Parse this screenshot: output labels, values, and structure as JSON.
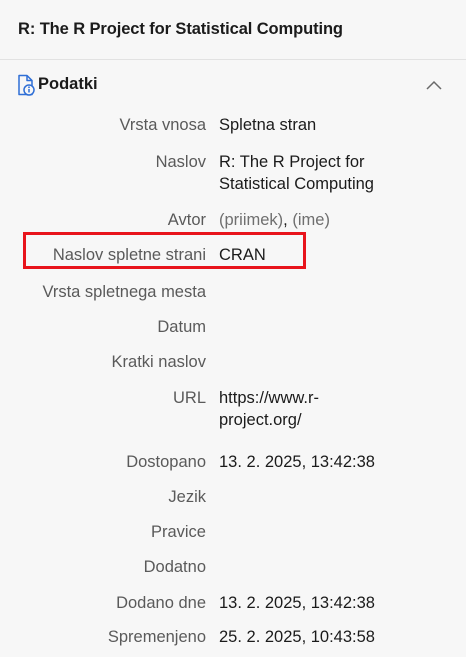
{
  "header": {
    "title": "R: The R Project for Statistical Computing"
  },
  "section": {
    "title": "Podatki",
    "icon": "document-info-icon",
    "collapse_icon": "chevron-up-icon"
  },
  "fields": {
    "item_type": {
      "label": "Vrsta vnosa",
      "value": "Spletna stran"
    },
    "title": {
      "label": "Naslov",
      "value_line1": "R: The R Project for",
      "value_line2": "Statistical Computing"
    },
    "author": {
      "label": "Avtor",
      "last": "(priimek)",
      "sep": ",",
      "first": "(ime)"
    },
    "website_title": {
      "label": "Naslov spletne strani",
      "value": "CRAN"
    },
    "website_type": {
      "label": "Vrsta spletnega mesta",
      "value": ""
    },
    "date": {
      "label": "Datum",
      "value": ""
    },
    "short_title": {
      "label": "Kratki naslov",
      "value": ""
    },
    "url": {
      "label": "URL",
      "value_line1": "https://www.r-",
      "value_line2": "project.org/"
    },
    "accessed": {
      "label": "Dostopano",
      "value": "13. 2. 2025, 13:42:38"
    },
    "language": {
      "label": "Jezik",
      "value": ""
    },
    "rights": {
      "label": "Pravice",
      "value": ""
    },
    "extra": {
      "label": "Dodatno",
      "value": ""
    },
    "date_added": {
      "label": "Dodano dne",
      "value": "13. 2. 2025, 13:42:38"
    },
    "modified": {
      "label": "Spremenjeno",
      "value": "25. 2. 2025, 10:43:58"
    }
  },
  "colors": {
    "highlight": "#e8141c",
    "icon_accent": "#2f6fd6"
  }
}
